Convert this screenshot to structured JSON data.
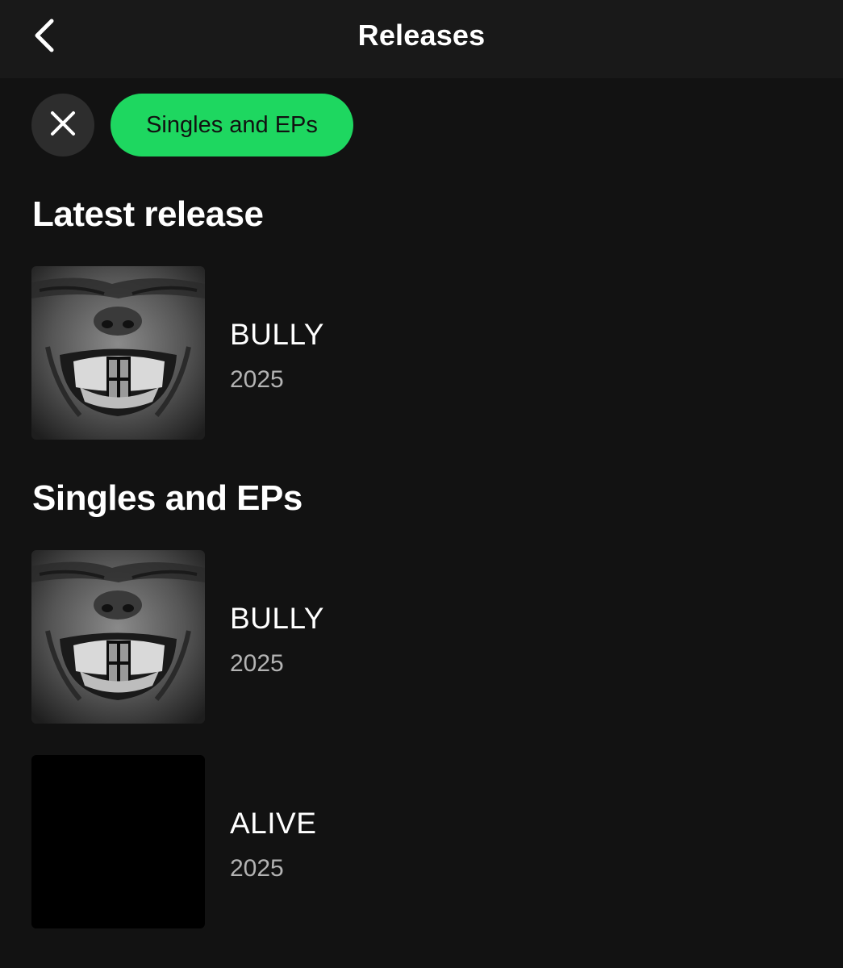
{
  "header": {
    "title": "Releases",
    "back_icon": "chevron-left-icon"
  },
  "filters": {
    "clear_icon": "close-icon",
    "active_chip": "Singles and EPs",
    "chip_color": "#1ed760"
  },
  "latest": {
    "heading": "Latest release",
    "items": [
      {
        "title": "BULLY",
        "year": "2025",
        "cover": "bully-cover"
      }
    ]
  },
  "singles": {
    "heading": "Singles and EPs",
    "items": [
      {
        "title": "BULLY",
        "year": "2025",
        "cover": "bully-cover"
      },
      {
        "title": "ALIVE",
        "year": "2025",
        "cover": "black-cover"
      }
    ]
  },
  "colors": {
    "background": "#121212",
    "topbar": "#191919",
    "accent": "#1ed760",
    "secondary_text": "#b3b3b3"
  }
}
